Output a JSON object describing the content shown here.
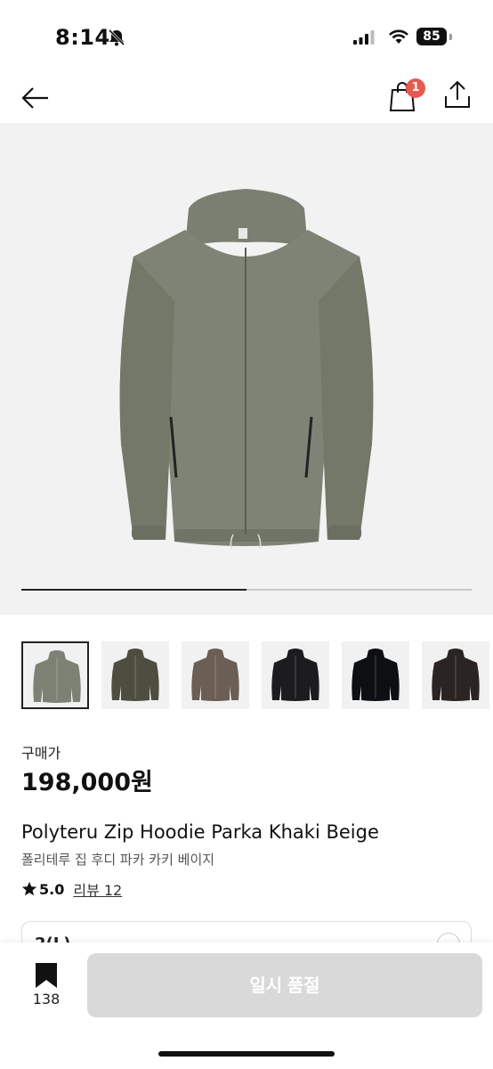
{
  "status_bar": {
    "time": "8:14",
    "battery": "85"
  },
  "header": {
    "cart_count": "1"
  },
  "gallery": {
    "progress_fraction": 0.5
  },
  "thumbnails": [
    {
      "color": "#7c8174"
    },
    {
      "color": "#4d4d40"
    },
    {
      "color": "#6b5e55"
    },
    {
      "color": "#1c1c1e"
    },
    {
      "color": "#0d0f12"
    },
    {
      "color": "#2a2522"
    }
  ],
  "product": {
    "price_label": "구매가",
    "price": "198,000원",
    "name_en": "Polyteru Zip Hoodie Parka Khaki Beige",
    "name_ko": "폴리테루 집 후디 파카 카키 베이지",
    "rating": "5.0",
    "review_link": "리뷰 12"
  },
  "option": {
    "partial_text": "2(L)"
  },
  "bottom_bar": {
    "bookmark_count": "138",
    "button_label": "일시 품절"
  }
}
